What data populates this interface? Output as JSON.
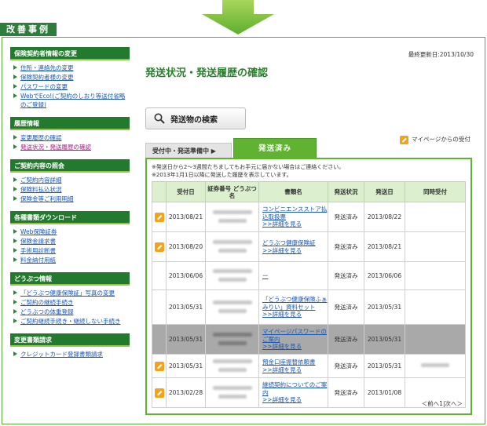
{
  "label": "改善事例",
  "sidebar": [
    {
      "header": "保険契約者情報の変更",
      "items": [
        "住所・連絡先の変更",
        "保険契約者様の変更",
        "パスワードの変更",
        "WebでEco!(ご契約のしおり等送付省略のご登録)"
      ]
    },
    {
      "header": "履歴情報",
      "items": [
        "変更履歴の確認",
        "発送状況・発送履歴の確認"
      ]
    },
    {
      "header": "ご契約内容の照会",
      "items": [
        "ご契約内容詳細",
        "保険料払込状況",
        "保険金等ご利用明細"
      ]
    },
    {
      "header": "各種書類ダウンロード",
      "items": [
        "Web保険証券",
        "保険金請求書",
        "手術用診断書",
        "料金納付用紙"
      ]
    },
    {
      "header": "どうぶつ情報",
      "items": [
        "「どうぶつ健康保険証」写真の変更",
        "ご契約の継続手続き",
        "どうぶつの体重登録",
        "ご契約継続手続き・継続しない手続き"
      ]
    },
    {
      "header": "変更書類請求",
      "items": [
        "クレジットカード登録書類請求"
      ]
    }
  ],
  "main": {
    "updated": "最終更新日:2013/10/30",
    "title": "発送状況・発送履歴の確認",
    "search_button": "発送物の検索",
    "tab_pending": "受付中・発送準備中 ▶",
    "tab_done": "発送済み",
    "mypage_note": "マイページからの受付",
    "notes": [
      "※発送日から2～3週間たちましてもお手元に届かない場合はご連絡ください。",
      "※2013年1月1日以降に発送した履歴を表示しています。"
    ],
    "columns": [
      "受付日",
      "証券番号 どうぶつ名",
      "書類名",
      "発送状況",
      "発送日",
      "同時受付"
    ],
    "rows": [
      {
        "icon": true,
        "accept_date": "2013/08/21",
        "docs": [
          "コンビニエンスストア払込取扱票",
          ">>詳細を見る"
        ],
        "status": "発送済み",
        "ship_date": "2013/08/22",
        "same": "",
        "gray": false
      },
      {
        "icon": true,
        "accept_date": "2013/08/20",
        "docs": [
          "どうぶつ健康保険証",
          ">>詳細を見る"
        ],
        "status": "発送済み",
        "ship_date": "2013/08/21",
        "same": "",
        "gray": false
      },
      {
        "icon": false,
        "accept_date": "2013/06/06",
        "docs": [
          "ー"
        ],
        "status": "発送済み",
        "ship_date": "2013/06/06",
        "same": "",
        "gray": false
      },
      {
        "icon": false,
        "accept_date": "2013/05/31",
        "docs": [
          "「どうぶつ健康保険ふぁみりい」資料セット",
          ">>詳細を見る"
        ],
        "status": "発送済み",
        "ship_date": "2013/05/31",
        "same": "",
        "gray": false
      },
      {
        "icon": false,
        "accept_date": "2013/05/31",
        "docs": [
          "マイページパスワードのご案内",
          ">>詳細を見る"
        ],
        "status": "発送済み",
        "ship_date": "2013/05/31",
        "same": "",
        "gray": true
      },
      {
        "icon": true,
        "accept_date": "2013/05/31",
        "docs": [
          "預金口座振替依頼書",
          ">>詳細を見る"
        ],
        "status": "発送済み",
        "ship_date": "2013/05/31",
        "same": "blurred",
        "gray": false
      },
      {
        "icon": true,
        "accept_date": "2013/02/28",
        "docs": [
          "継続契約についてのご案内",
          ">>詳細を見る"
        ],
        "status": "発送済み",
        "ship_date": "2013/01/08",
        "same": "",
        "gray": false
      }
    ],
    "pager": "＜前へ1|次へ＞"
  },
  "colors": {
    "brand_green": "#237a2e",
    "tab_green": "#5fb331",
    "link": "#1a57b3",
    "header_bg": "#dcefcf",
    "highlight_row": "#a9a9a9"
  }
}
